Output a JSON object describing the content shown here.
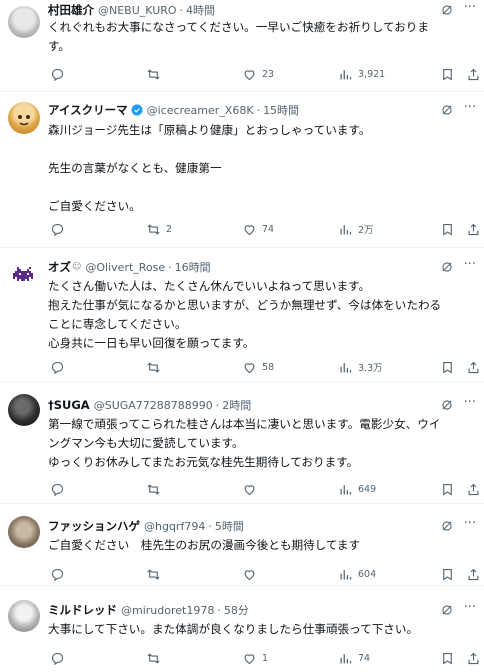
{
  "tweets": [
    {
      "name": "村田雄介",
      "verified": false,
      "handle": "@NEBU_KURO",
      "sep": "·",
      "time": "4時間",
      "lines": [
        "くれぐれもお大事になさってください。一早いご快癒をお祈りしておりま",
        "す。"
      ],
      "reply": "",
      "retweet": "",
      "like": "23",
      "views": "3,921"
    },
    {
      "name": "アイスクリーマ",
      "verified": true,
      "handle": "@icecreamer_X68K",
      "sep": "·",
      "time": "15時間",
      "lines": [
        "森川ジョージ先生は「原稿より健康」とおっしゃっています。",
        "",
        "先生の言葉がなくとも、健康第一",
        "",
        "ご自愛ください。"
      ],
      "reply": "",
      "retweet": "2",
      "like": "74",
      "views": "2万"
    },
    {
      "name": "オズ",
      "name_suffix": "😷",
      "verified": false,
      "handle": "@Olivert_Rose",
      "sep": "·",
      "time": "16時間",
      "lines": [
        "たくさん働いた人は、たくさん休んでいいよねって思います。",
        "抱えた仕事が気になるかと思いますが、どうか無理せず、今は体をいたわる",
        "ことに専念してください。",
        "心身共に一日も早い回復を願ってます。"
      ],
      "reply": "",
      "retweet": "",
      "like": "58",
      "views": "3.3万"
    },
    {
      "name": "†SUGA",
      "verified": false,
      "handle": "@SUGA77288788990",
      "sep": "·",
      "time": "2時間",
      "lines": [
        "第一線で頑張ってこられた桂さんは本当に凄いと思います。電影少女、ウイ",
        "ングマン今も大切に愛読しています。",
        "ゆっくりお休みしてまたお元気な桂先生期待しております。"
      ],
      "reply": "",
      "retweet": "",
      "like": "",
      "views": "649"
    },
    {
      "name": "ファッションハゲ",
      "verified": false,
      "handle": "@hgqrf794",
      "sep": "·",
      "time": "5時間",
      "lines": [
        "ご自愛ください　桂先生のお尻の漫画今後とも期待してます"
      ],
      "reply": "",
      "retweet": "",
      "like": "",
      "views": "604"
    },
    {
      "name": "ミルドレッド",
      "verified": false,
      "handle": "@mirudoret1978",
      "sep": "·",
      "time": "58分",
      "lines": [
        "大事にして下さい。また体調が良くなりましたら仕事頑張って下さい。"
      ],
      "reply": "",
      "retweet": "",
      "like": "1",
      "views": "74"
    }
  ],
  "colors": {
    "text": "#0f1419",
    "muted": "#536471",
    "verified": "#1d9bf0",
    "divider": "#eff3f4"
  },
  "icons": [
    "reply-icon",
    "retweet-icon",
    "like-icon",
    "views-icon",
    "bookmark-icon",
    "share-icon",
    "grok-icon",
    "more-icon",
    "verified-badge-icon"
  ]
}
